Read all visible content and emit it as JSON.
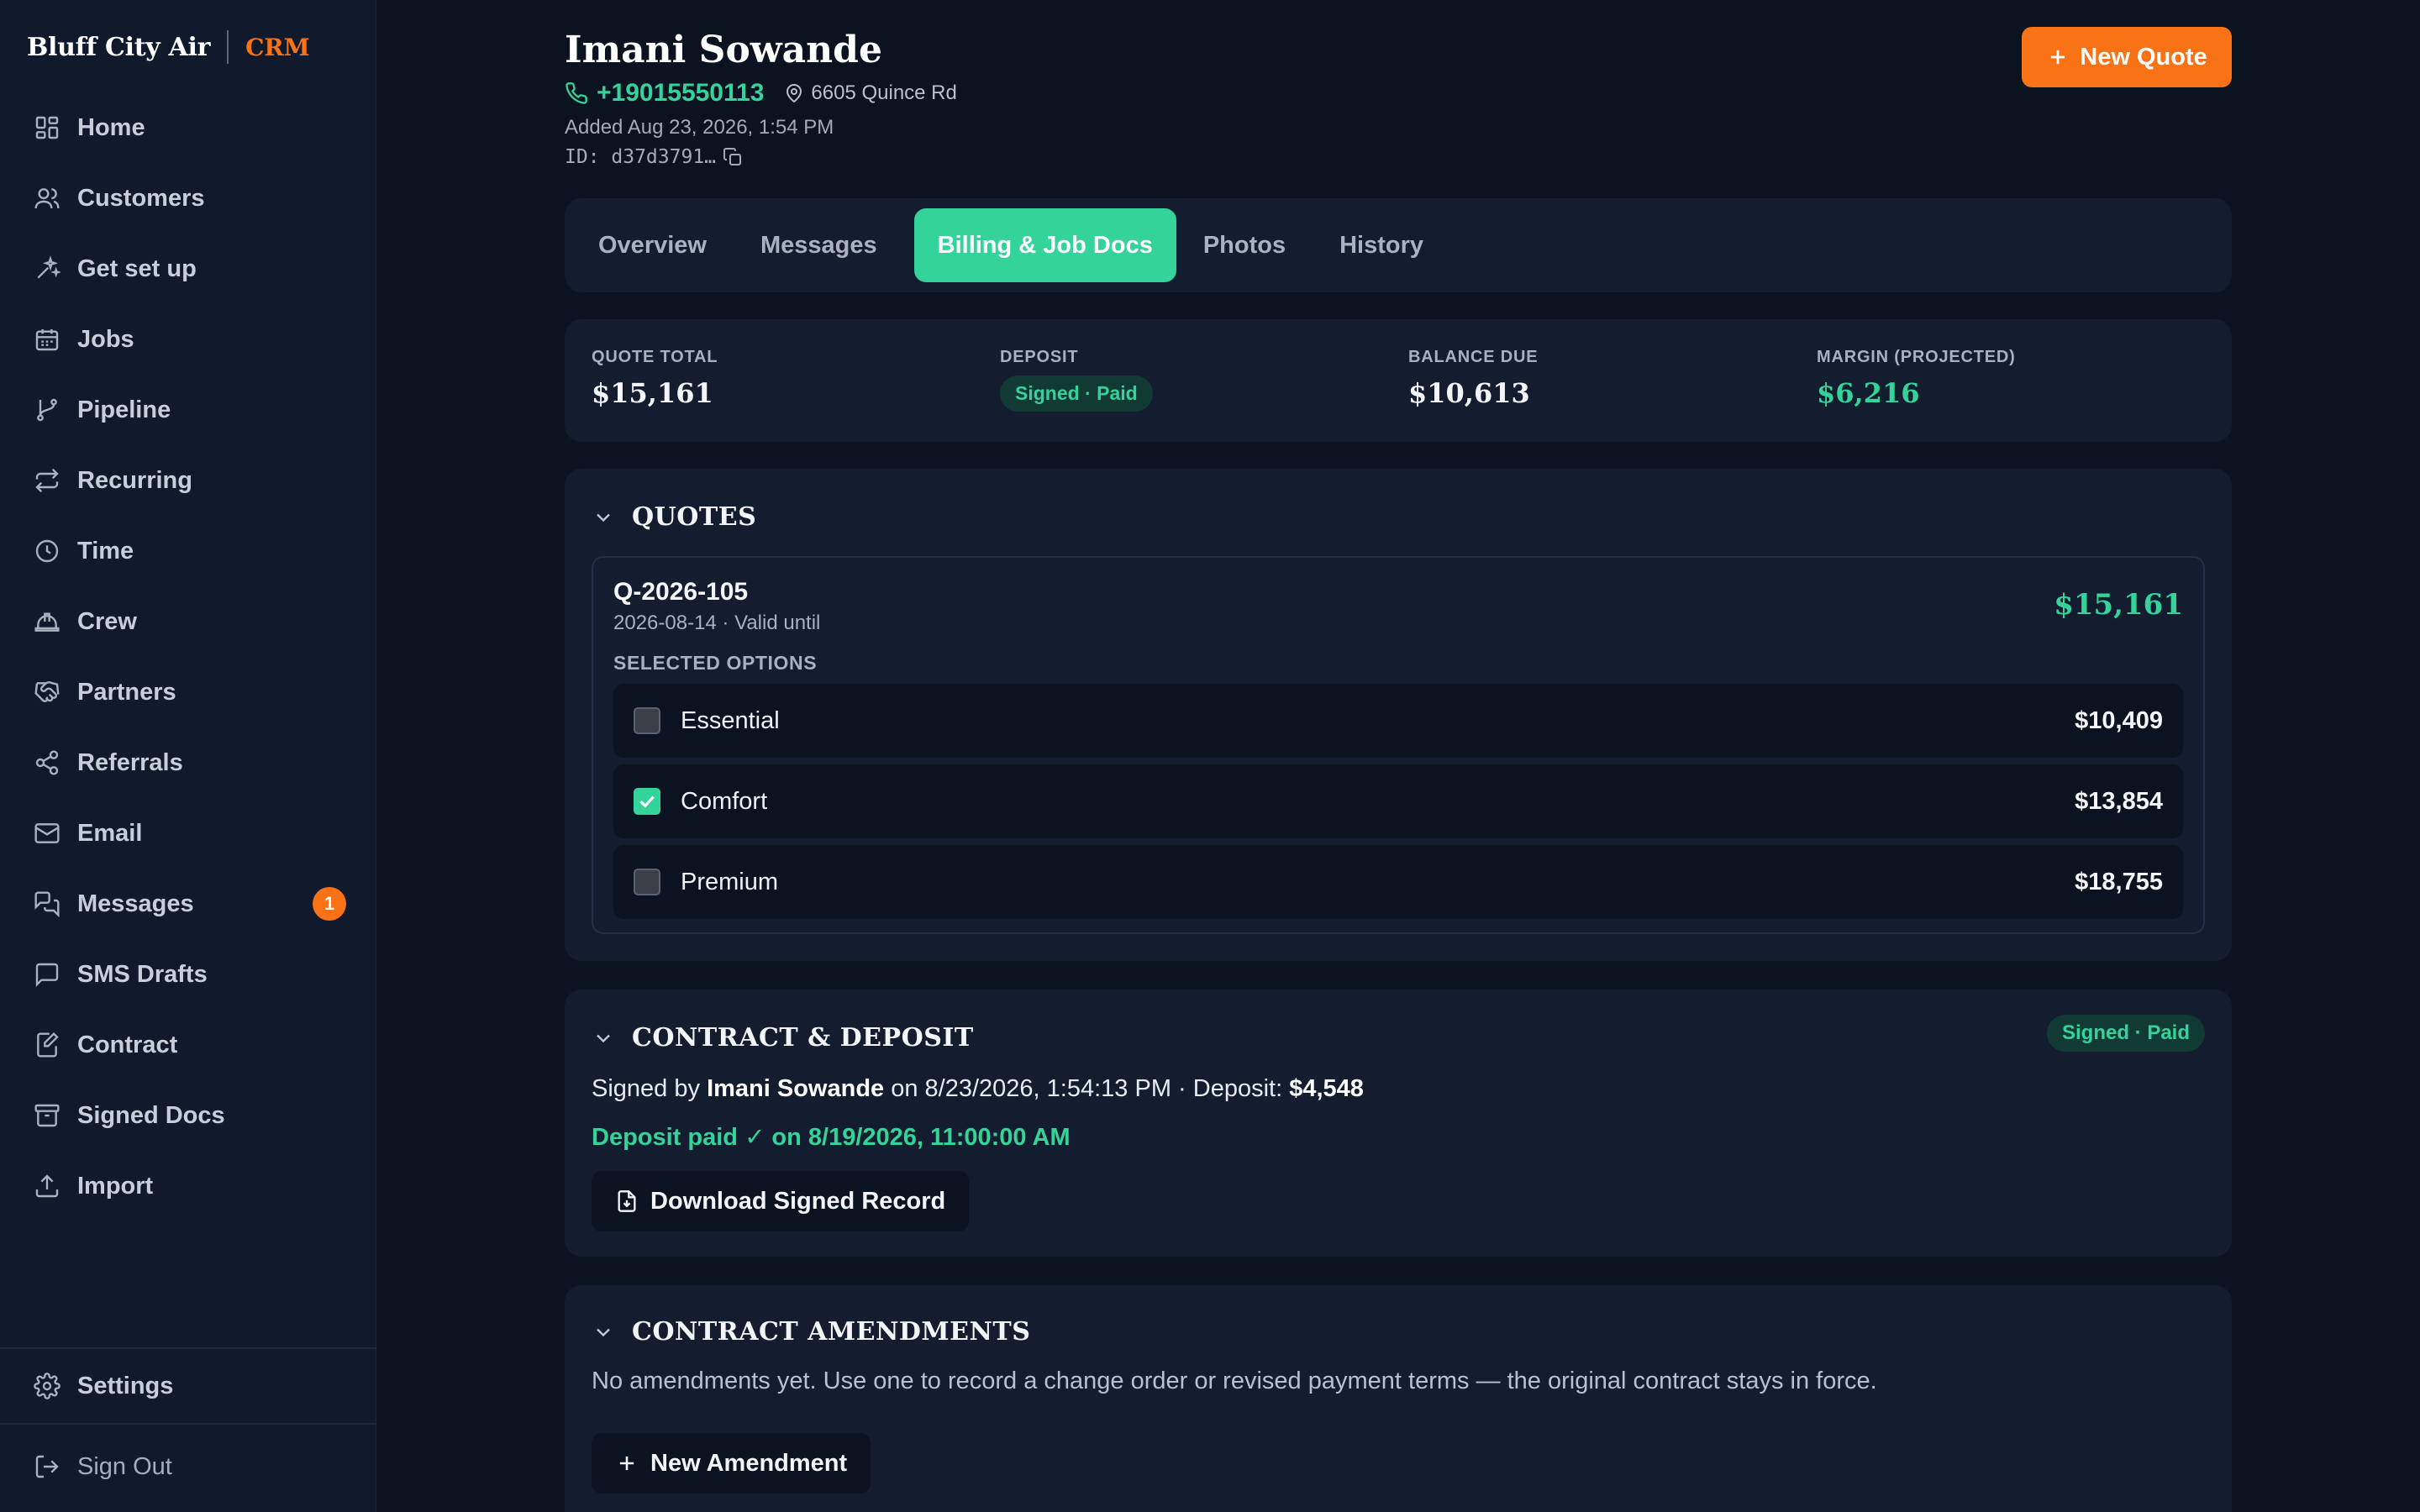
{
  "brand": {
    "name": "Bluff City Air",
    "tag": "CRM"
  },
  "sidebar": {
    "items": [
      {
        "label": "Home",
        "icon": "home-icon"
      },
      {
        "label": "Customers",
        "icon": "users-icon"
      },
      {
        "label": "Get set up",
        "icon": "sparkles-icon"
      },
      {
        "label": "Jobs",
        "icon": "calendar-icon"
      },
      {
        "label": "Pipeline",
        "icon": "git-branch-icon"
      },
      {
        "label": "Recurring",
        "icon": "repeat-icon"
      },
      {
        "label": "Time",
        "icon": "clock-icon"
      },
      {
        "label": "Crew",
        "icon": "hard-hat-icon"
      },
      {
        "label": "Partners",
        "icon": "handshake-icon"
      },
      {
        "label": "Referrals",
        "icon": "share-icon"
      },
      {
        "label": "Email",
        "icon": "mail-icon"
      },
      {
        "label": "Messages",
        "icon": "messages-icon",
        "badge": "1"
      },
      {
        "label": "SMS Drafts",
        "icon": "message-square-icon"
      },
      {
        "label": "Contract",
        "icon": "file-signature-icon"
      },
      {
        "label": "Signed Docs",
        "icon": "archive-icon"
      },
      {
        "label": "Import",
        "icon": "upload-icon"
      }
    ],
    "settings": "Settings",
    "sign_out": "Sign Out"
  },
  "customer": {
    "name": "Imani Sowande",
    "phone": "+19015550113",
    "address": "6605 Quince Rd",
    "added": "Added Aug 23, 2026, 1:54 PM",
    "id": "ID: d37d3791…"
  },
  "header": {
    "new_quote": "New Quote"
  },
  "tabs": [
    {
      "label": "Overview",
      "active": false
    },
    {
      "label": "Messages",
      "active": false
    },
    {
      "label": "Billing & Job Docs",
      "active": true
    },
    {
      "label": "Photos",
      "active": false
    },
    {
      "label": "History",
      "active": false
    }
  ],
  "stats": {
    "quote_total": {
      "label": "QUOTE TOTAL",
      "value": "$15,161"
    },
    "deposit": {
      "label": "DEPOSIT",
      "value": "Signed · Paid"
    },
    "balance": {
      "label": "BALANCE DUE",
      "value": "$10,613"
    },
    "margin": {
      "label": "MARGIN (PROJECTED)",
      "value": "$6,216"
    }
  },
  "quotes": {
    "title": "QUOTES",
    "quote": {
      "id": "Q-2026-105",
      "date": "2026-08-14 · Valid until",
      "total": "$15,161",
      "options_label": "SELECTED OPTIONS",
      "options": [
        {
          "name": "Essential",
          "price": "$10,409",
          "checked": false
        },
        {
          "name": "Comfort",
          "price": "$13,854",
          "checked": true
        },
        {
          "name": "Premium",
          "price": "$18,755",
          "checked": false
        }
      ]
    }
  },
  "contract": {
    "title": "CONTRACT & DEPOSIT",
    "status": "Signed · Paid",
    "signed_prefix": "Signed by",
    "signer": "Imani Sowande",
    "signed_on": "on 8/23/2026, 1:54:13 PM · Deposit:",
    "deposit_amount": "$4,548",
    "deposit_paid": "Deposit paid ✓ on 8/19/2026, 11:00:00 AM",
    "download": "Download Signed Record"
  },
  "amendments": {
    "title": "CONTRACT AMENDMENTS",
    "empty_text": "No amendments yet. Use one to record a change order or revised payment terms — the original contract stays in force.",
    "new_button": "New Amendment"
  },
  "colors": {
    "accent_green": "#34d399",
    "accent_orange": "#f97316",
    "bg": "#0b1220",
    "card": "#131d2f"
  }
}
